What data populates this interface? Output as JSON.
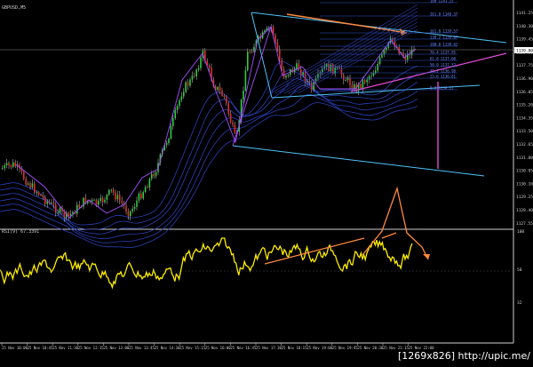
{
  "chart": {
    "symbol": "GBPUSD,M5",
    "rsi_label": "RSI(9) 67.3391",
    "price_ticks": [
      "1141.25",
      "1140.30",
      "1139.45",
      "1138.60",
      "1137.75",
      "1136.90",
      "1136.05",
      "1135.20",
      "1134.35",
      "1133.50",
      "1132.65",
      "1131.80",
      "1130.95",
      "1130.10",
      "1129.25",
      "1128.40",
      "1127.55"
    ],
    "price_current": "1139.80",
    "rsi_ticks": [
      "100",
      "50",
      "32"
    ],
    "time_ticks": [
      "25 Nov 10:00",
      "25 Nov 10:45",
      "25 Nov 11:30",
      "25 Nov 12:15",
      "25 Nov 13:00",
      "25 Nov 13:45",
      "25 Nov 14:30",
      "25 Nov 15:15",
      "25 Nov 16:00",
      "25 Nov 16:45",
      "25 Nov 17:30",
      "25 Nov 18:15",
      "25 Nov 19:00",
      "25 Nov 19:45",
      "25 Nov 20:30",
      "25 Nov 21:15",
      "25 Nov 22:00"
    ],
    "fib_labels": [
      "100 1141.25",
      "261.8 1140.37",
      "161.8 1139.57",
      "138.2 1139.07",
      "100.0 1138.62",
      "76.4 1137.95",
      "61.8 1137.60",
      "50.0 1137.32",
      "38.2 1136.98",
      "23.6 1136.61",
      "0.0 1136.15"
    ],
    "colors": {
      "bull": "#2ecc40",
      "bear": "#e0302a",
      "wick": "#cfcfcf",
      "trend": "#4fc3f7",
      "band": "#2a3fb5",
      "zigzag": "#a64dff",
      "arrow": "#ff8a3d",
      "target": "#e24ad6",
      "rsi": "#ffee00",
      "grid": "#cfcfcf"
    }
  },
  "watermark": "[1269x826] http://upic.me/"
}
